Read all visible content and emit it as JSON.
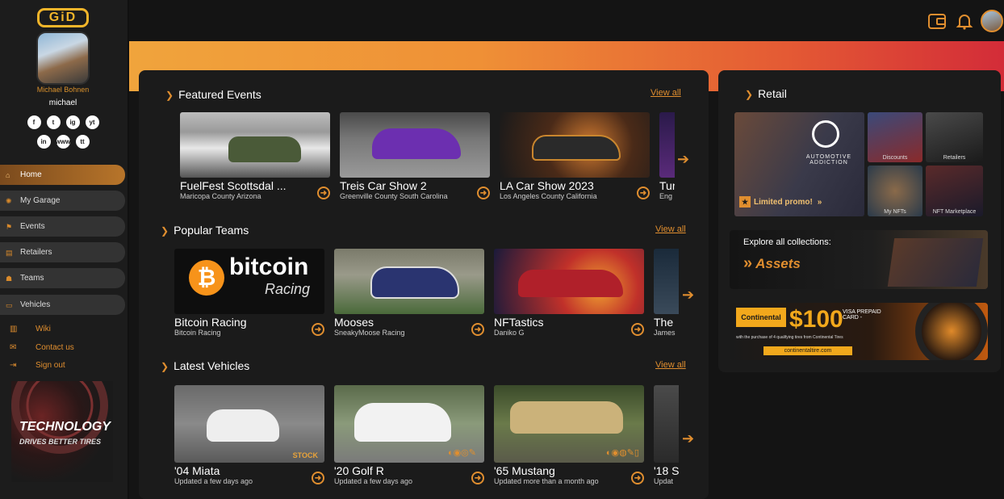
{
  "brand": {
    "logo": "GiD"
  },
  "user": {
    "full_name": "Michael Bohnen",
    "handle": "michael"
  },
  "socials": [
    "f",
    "t",
    "ig",
    "yt",
    "in",
    "www",
    "tt"
  ],
  "nav": [
    {
      "label": "Home",
      "icon": "home-icon",
      "active": true
    },
    {
      "label": "My Garage",
      "icon": "wheel-icon"
    },
    {
      "label": "Events",
      "icon": "flag-icon"
    },
    {
      "label": "Retailers",
      "icon": "store-icon"
    },
    {
      "label": "Teams",
      "icon": "people-icon"
    },
    {
      "label": "Vehicles",
      "icon": "car-icon"
    }
  ],
  "links": [
    {
      "label": "Wiki",
      "icon": "book-icon"
    },
    {
      "label": "Contact us",
      "icon": "mail-icon"
    },
    {
      "label": "Sign out",
      "icon": "signout-icon"
    }
  ],
  "side_ad": {
    "line1": "TECHNOLOGY",
    "line2": "DRIVES BETTER TIRES"
  },
  "sections": {
    "featured": {
      "title": "Featured Events",
      "view_all": "View all",
      "items": [
        {
          "title": "FuelFest Scottsdal ...",
          "sub": "Maricopa County Arizona"
        },
        {
          "title": "Treis Car Show 2",
          "sub": "Greenville County South Carolina"
        },
        {
          "title": "LA Car Show 2023",
          "sub": "Los Angeles County California"
        },
        {
          "title": "Tur",
          "sub": "Eng"
        }
      ]
    },
    "teams": {
      "title": "Popular Teams",
      "view_all": "View all",
      "items": [
        {
          "title": "Bitcoin Racing",
          "sub": "Bitcoin Racing",
          "img_text": "bitcoin",
          "img_text2": "Racing"
        },
        {
          "title": "Mooses",
          "sub": "SneakyMoose Racing"
        },
        {
          "title": "NFTastics",
          "sub": "Daniko G"
        },
        {
          "title": "The",
          "sub": "James"
        }
      ]
    },
    "vehicles": {
      "title": "Latest Vehicles",
      "view_all": "View all",
      "items": [
        {
          "title": "'04 Miata",
          "sub": "Updated a few days ago",
          "tag": "STOCK"
        },
        {
          "title": "'20 Golf R",
          "sub": "Updated a few days ago"
        },
        {
          "title": "'65 Mustang",
          "sub": "Updated more than a month ago"
        },
        {
          "title": "'18 S",
          "sub": "Updat"
        }
      ]
    }
  },
  "retail": {
    "title": "Retail",
    "main_tile": {
      "brand": "AUTOMOTIVE ADDICTION",
      "promo": "Limited promo!"
    },
    "tiles": [
      "Discounts",
      "Retailers",
      "My NFTs",
      "NFT Marketplace"
    ],
    "assets": {
      "line1": "Explore all collections:",
      "line2": "Assets"
    },
    "continental": {
      "brand": "Continental",
      "amount": "$100",
      "card": "VISA PREPAID CARD -",
      "url": "continentaltire.com",
      "fine": "with the purchase of 4 qualifying tires from Continental Tires"
    }
  }
}
